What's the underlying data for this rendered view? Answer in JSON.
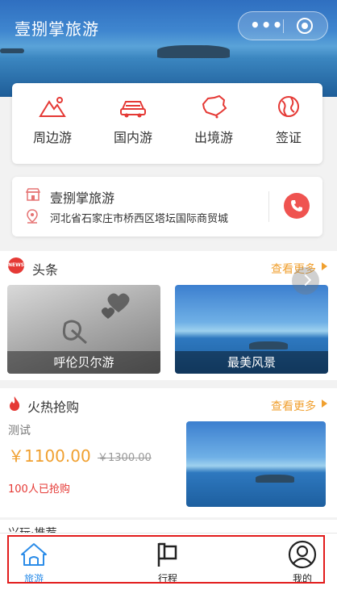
{
  "header": {
    "title": "壹捌掌旅游"
  },
  "categories": [
    {
      "label": "周边游",
      "icon": "mountain-icon"
    },
    {
      "label": "国内游",
      "icon": "car-icon"
    },
    {
      "label": "出境游",
      "icon": "china-map-icon"
    },
    {
      "label": "签证",
      "icon": "globe-icon"
    }
  ],
  "shop": {
    "name": "壹捌掌旅游",
    "address": "河北省石家庄市桥西区塔坛国际商贸城"
  },
  "headlines": {
    "title": "头条",
    "badge": "NEWS",
    "more": "查看更多",
    "items": [
      {
        "caption": "呼伦贝尔游"
      },
      {
        "caption": "最美风景"
      }
    ]
  },
  "hot": {
    "title": "火热抢购",
    "more": "查看更多",
    "item": {
      "name": "测试",
      "price": "￥1100.00",
      "original_price": "￥1300.00",
      "sold": "100人已抢购"
    }
  },
  "peek_section": {
    "title": "兴玩·推荐"
  },
  "tabbar": {
    "tabs": [
      {
        "label": "旅游",
        "active": true
      },
      {
        "label": "行程",
        "active": false
      },
      {
        "label": "我的",
        "active": false
      }
    ]
  },
  "colors": {
    "accent_red": "#e53935",
    "accent_orange": "#f0a030",
    "active_tab": "#2b8ce8"
  }
}
